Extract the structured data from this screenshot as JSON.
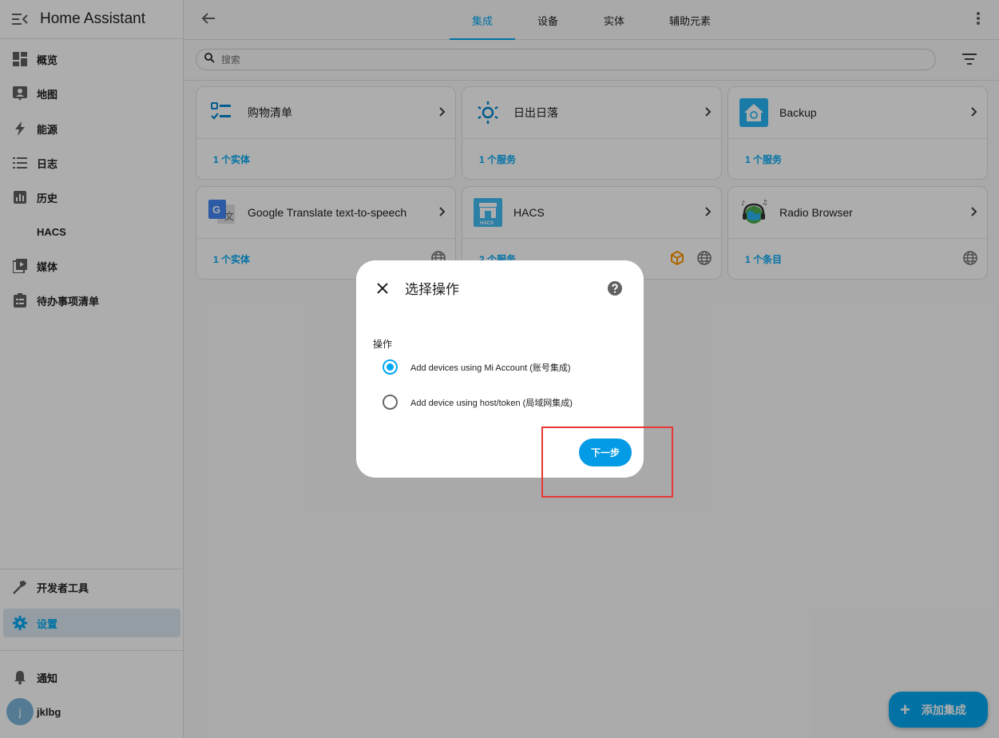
{
  "app": {
    "title": "Home Assistant"
  },
  "sidebar": {
    "items": [
      {
        "label": "概览",
        "icon": "dashboard-icon"
      },
      {
        "label": "地图",
        "icon": "map-icon"
      },
      {
        "label": "能源",
        "icon": "lightning-icon"
      },
      {
        "label": "日志",
        "icon": "list-icon"
      },
      {
        "label": "历史",
        "icon": "chart-icon"
      },
      {
        "label": "HACS",
        "icon": ""
      },
      {
        "label": "媒体",
        "icon": "media-icon"
      },
      {
        "label": "待办事项清单",
        "icon": "clipboard-icon"
      }
    ],
    "bottom": [
      {
        "label": "开发者工具",
        "icon": "hammer-icon"
      },
      {
        "label": "设置",
        "icon": "gear-icon"
      }
    ],
    "notifications_label": "通知",
    "user": {
      "initial": "j",
      "name": "jklbg"
    }
  },
  "tabs": [
    {
      "label": "集成",
      "active": true
    },
    {
      "label": "设备",
      "active": false
    },
    {
      "label": "实体",
      "active": false
    },
    {
      "label": "辅助元素",
      "active": false
    }
  ],
  "search": {
    "placeholder": "搜索"
  },
  "cards": [
    {
      "name": "购物清单",
      "link": "1 个实体",
      "icon": "shopping-list-icon"
    },
    {
      "name": "日出日落",
      "link": "1 个服务",
      "icon": "sun-icon"
    },
    {
      "name": "Backup",
      "link": "1 个服务",
      "icon": "backup-icon"
    },
    {
      "name": "Google Translate text-to-speech",
      "link": "1 个实体",
      "icon": "google-translate-icon"
    },
    {
      "name": "HACS",
      "link": "2 个服务",
      "icon": "hacs-icon"
    },
    {
      "name": "Radio Browser",
      "link": "1 个条目",
      "icon": "radio-browser-icon"
    }
  ],
  "fab": {
    "label": "添加集成"
  },
  "dialog": {
    "title": "选择操作",
    "field_label": "操作",
    "options": [
      {
        "label": "Add devices using Mi Account (账号集成)",
        "selected": true
      },
      {
        "label": "Add device using host/token (局域网集成)",
        "selected": false
      }
    ],
    "next_label": "下一步"
  },
  "colors": {
    "accent": "#03a9f4",
    "highlight": "#e53935"
  }
}
